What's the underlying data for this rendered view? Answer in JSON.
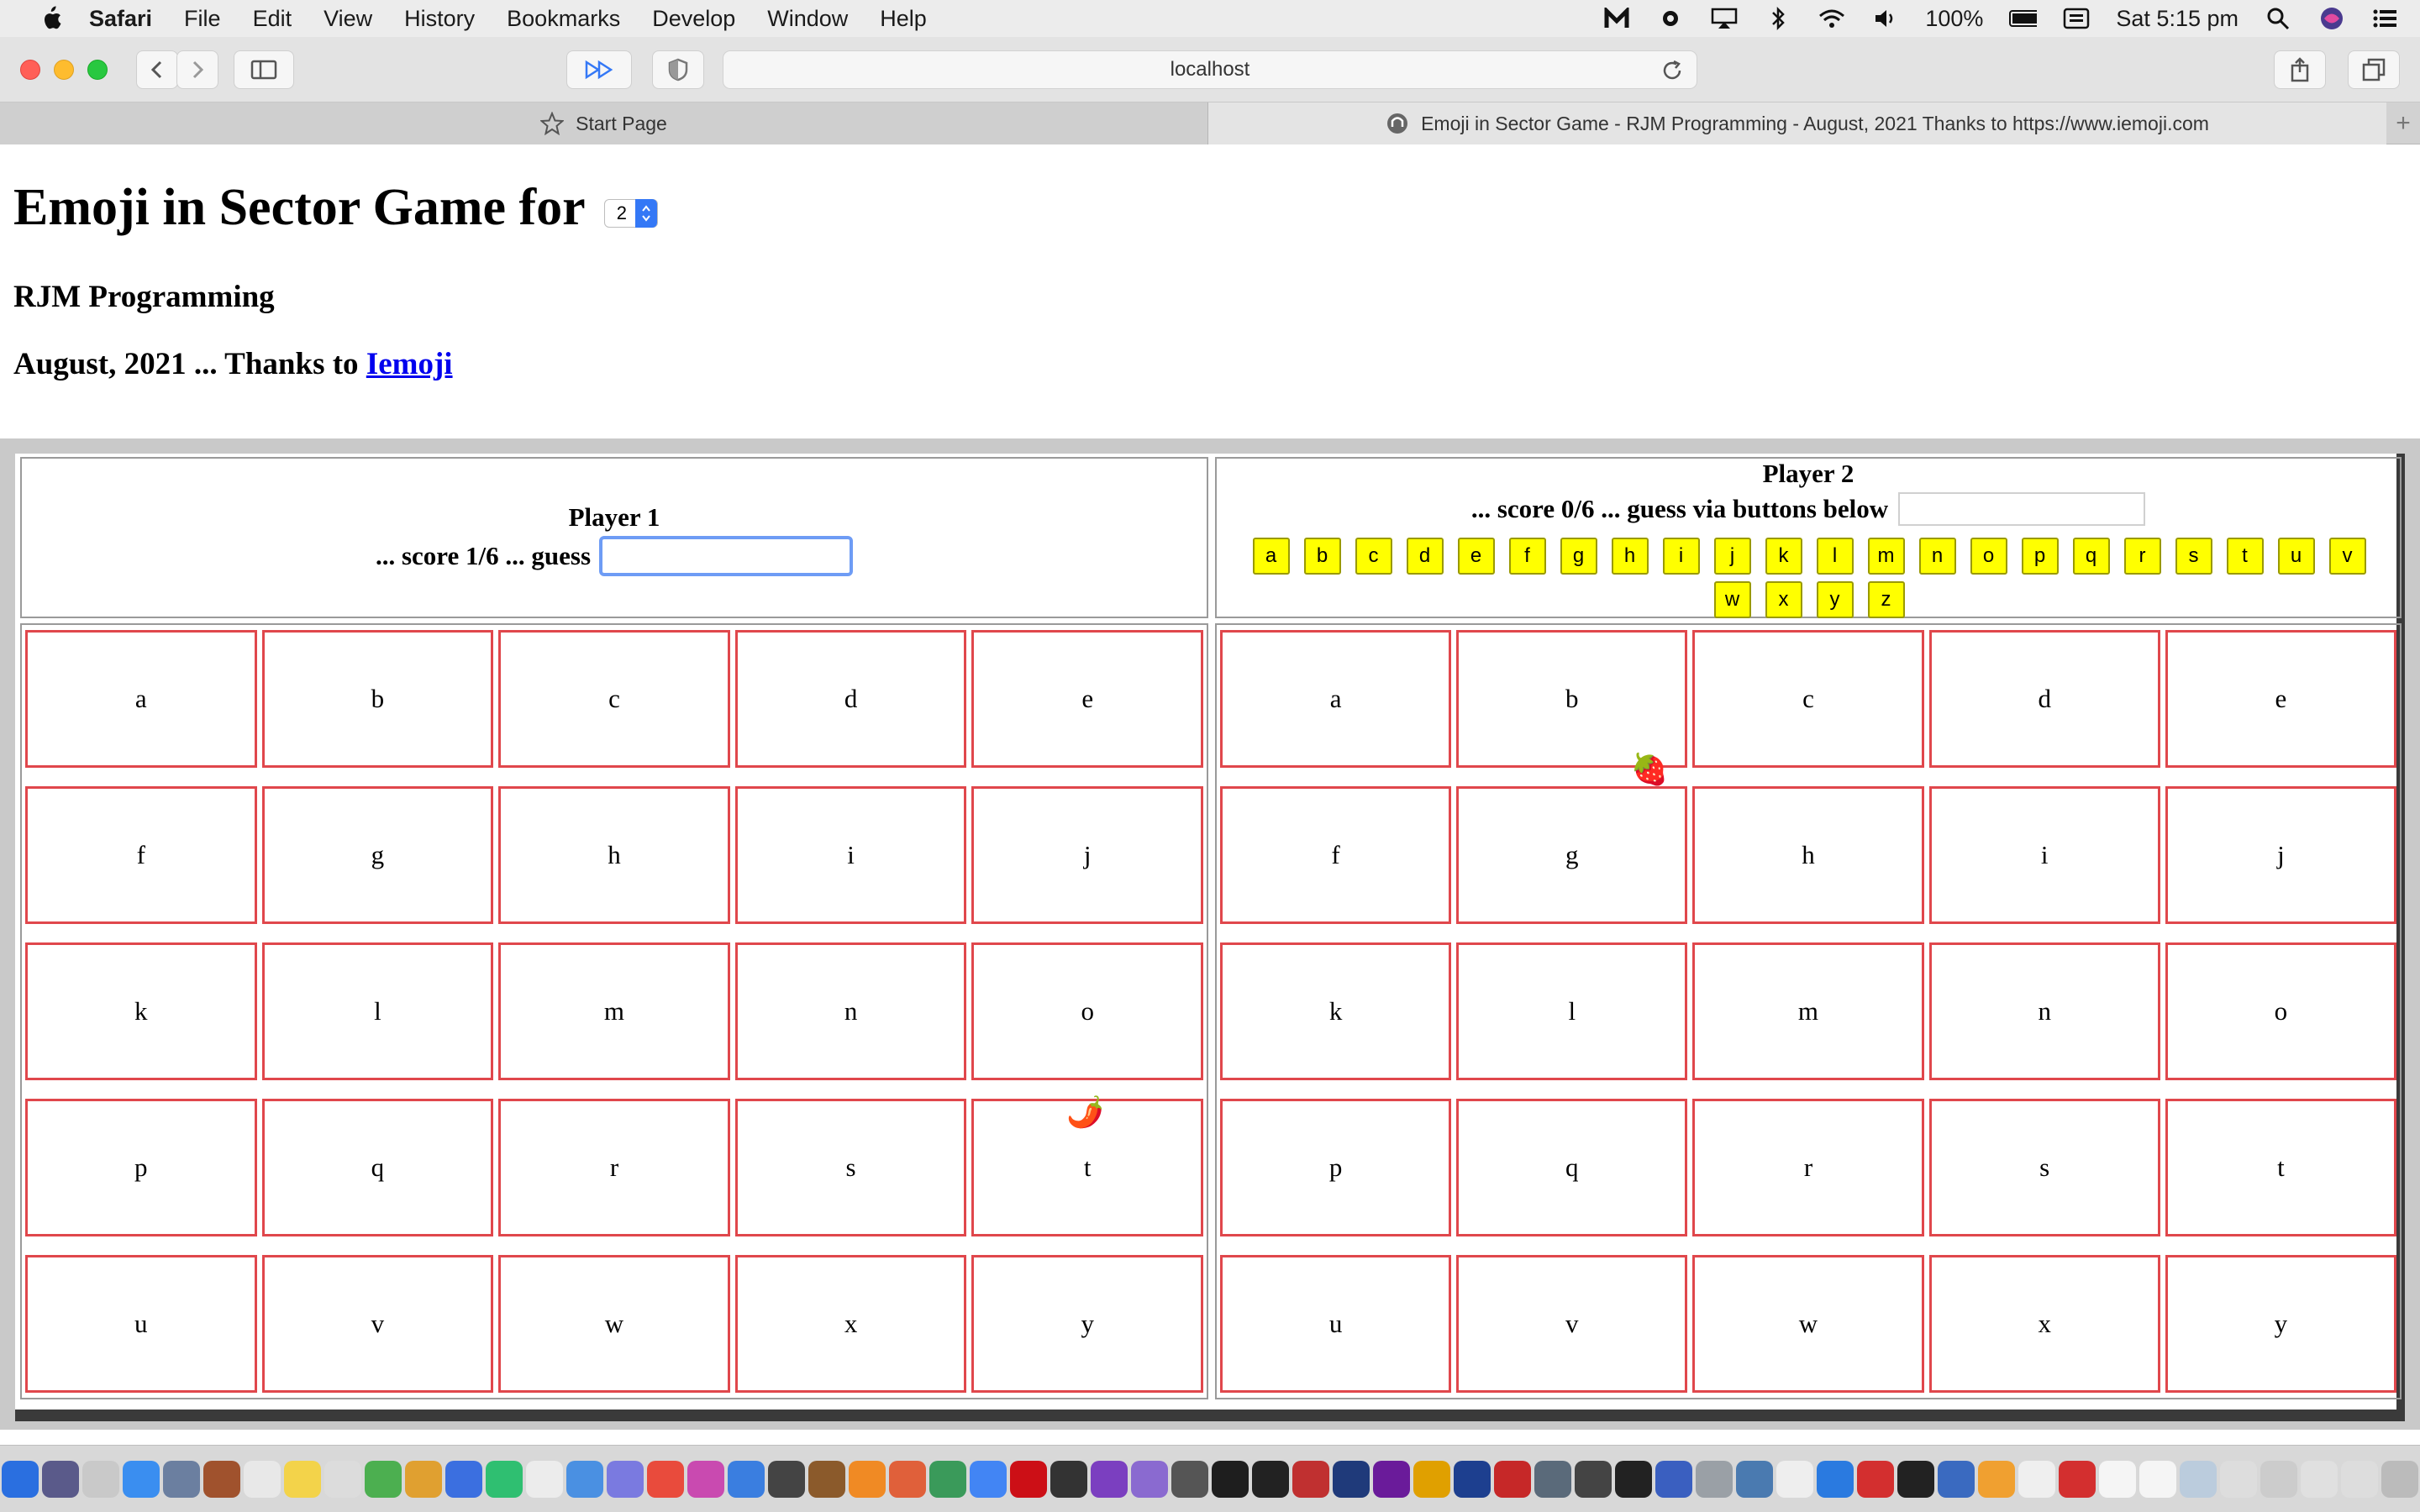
{
  "menubar": {
    "items": [
      "Safari",
      "File",
      "Edit",
      "View",
      "History",
      "Bookmarks",
      "Develop",
      "Window",
      "Help"
    ],
    "battery": "100%",
    "clock": "Sat 5:15 pm"
  },
  "browser": {
    "url": "localhost",
    "tabs": [
      {
        "label": "Start Page",
        "active": false
      },
      {
        "label": "Emoji in Sector Game - RJM Programming - August, 2021 Thanks to https://www.iemoji.com",
        "active": true
      }
    ]
  },
  "page": {
    "title": "Emoji in Sector Game for",
    "player_select_value": "2",
    "subtitle": "RJM Programming",
    "credit_prefix": "August, 2021 ... Thanks to",
    "credit_link": "Iemoji"
  },
  "player1": {
    "title": "Player 1",
    "score_text": "... score 1/6 ... guess",
    "guess_value": "",
    "cells": [
      "a",
      "b",
      "c",
      "d",
      "e",
      "f",
      "g",
      "h",
      "i",
      "j",
      "k",
      "l",
      "m",
      "n",
      "o",
      "p",
      "q",
      "r",
      "s",
      "t",
      "u",
      "v",
      "w",
      "x",
      "y"
    ],
    "emoji": "🌶️"
  },
  "player2": {
    "title": "Player 2",
    "score_text": "... score 0/6 ... guess via buttons below",
    "guess_value": "",
    "buttons": [
      "a",
      "b",
      "c",
      "d",
      "e",
      "f",
      "g",
      "h",
      "i",
      "j",
      "k",
      "l",
      "m",
      "n",
      "o",
      "p",
      "q",
      "r",
      "s",
      "t",
      "u",
      "v",
      "w",
      "x",
      "y",
      "z"
    ],
    "cells": [
      "a",
      "b",
      "c",
      "d",
      "e",
      "f",
      "g",
      "h",
      "i",
      "j",
      "k",
      "l",
      "m",
      "n",
      "o",
      "p",
      "q",
      "r",
      "s",
      "t",
      "u",
      "v",
      "w",
      "x",
      "y"
    ],
    "emoji": "🍓"
  },
  "colors": {
    "cell_border": "#e0474c",
    "button_yellow": "#ffff00",
    "link": "#0000ee"
  }
}
